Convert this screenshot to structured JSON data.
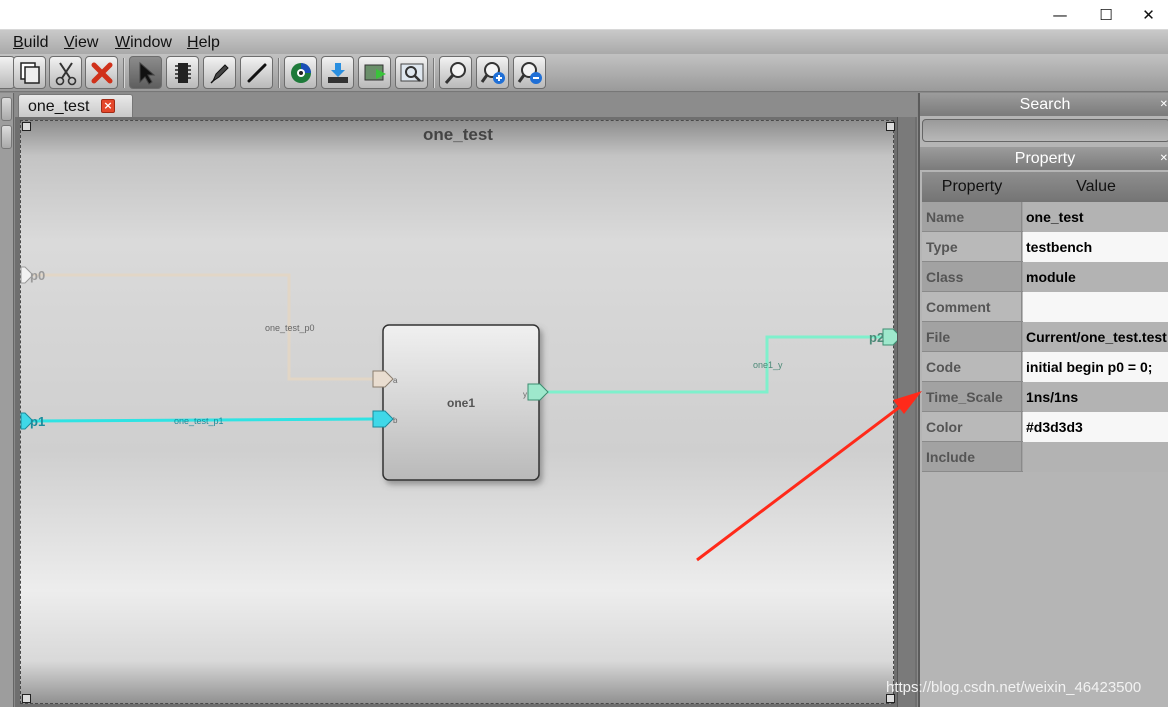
{
  "window": {
    "minimize_glyph": "—",
    "maximize_glyph": "☐",
    "close_glyph": "✕"
  },
  "menu": {
    "items": [
      {
        "label_acc": "B",
        "label_rest": "uild"
      },
      {
        "label_acc": "V",
        "label_rest": "iew"
      },
      {
        "label_acc": "W",
        "label_rest": "indow"
      },
      {
        "label_acc": "H",
        "label_rest": "elp"
      }
    ]
  },
  "toolbar": {
    "icons": [
      "copy-icon",
      "cut-icon",
      "delete-icon",
      "select-pointer-icon",
      "chip-icon",
      "pen-icon",
      "wire-icon",
      "simulate-icon",
      "download-icon",
      "run-icon",
      "zoom-fit-icon",
      "zoom-icon",
      "zoom-in-icon",
      "zoom-out-icon"
    ]
  },
  "tab": {
    "label": "one_test",
    "close_glyph": "×"
  },
  "canvas": {
    "title": "one_test",
    "module": {
      "name": "one1",
      "ports": [
        "a",
        "b",
        "y"
      ]
    },
    "pins": {
      "p0": "p0",
      "p1": "p1",
      "p2": "p2"
    },
    "wires": {
      "w0": "one_test_p0",
      "w1": "one_test_p1",
      "w2": "one1_y"
    },
    "colors": {
      "p0_wire": "#e2d6c6",
      "p1_wire": "#2fe3e3",
      "p2_wire": "#7ff0cc"
    }
  },
  "search_panel": {
    "title": "Search",
    "pin": "✕"
  },
  "property_panel": {
    "title": "Property",
    "pin": "✕",
    "col_property": "Property",
    "col_value": "Value",
    "rows": [
      {
        "key": "Name",
        "value": "one_test"
      },
      {
        "key": "Type",
        "value": "testbench"
      },
      {
        "key": "Class",
        "value": "module"
      },
      {
        "key": "Comment",
        "value": ""
      },
      {
        "key": "File",
        "value": "Current/one_test.test"
      },
      {
        "key": "Code",
        "value": "initial begin p0 = 0;"
      },
      {
        "key": "Time_Scale",
        "value": "1ns/1ns"
      },
      {
        "key": "Color",
        "value": "#d3d3d3"
      },
      {
        "key": "Include",
        "value": ""
      }
    ]
  },
  "watermark": "https://blog.csdn.net/weixin_46423500",
  "annotation": {
    "arrow_color": "#ff2a1a"
  }
}
